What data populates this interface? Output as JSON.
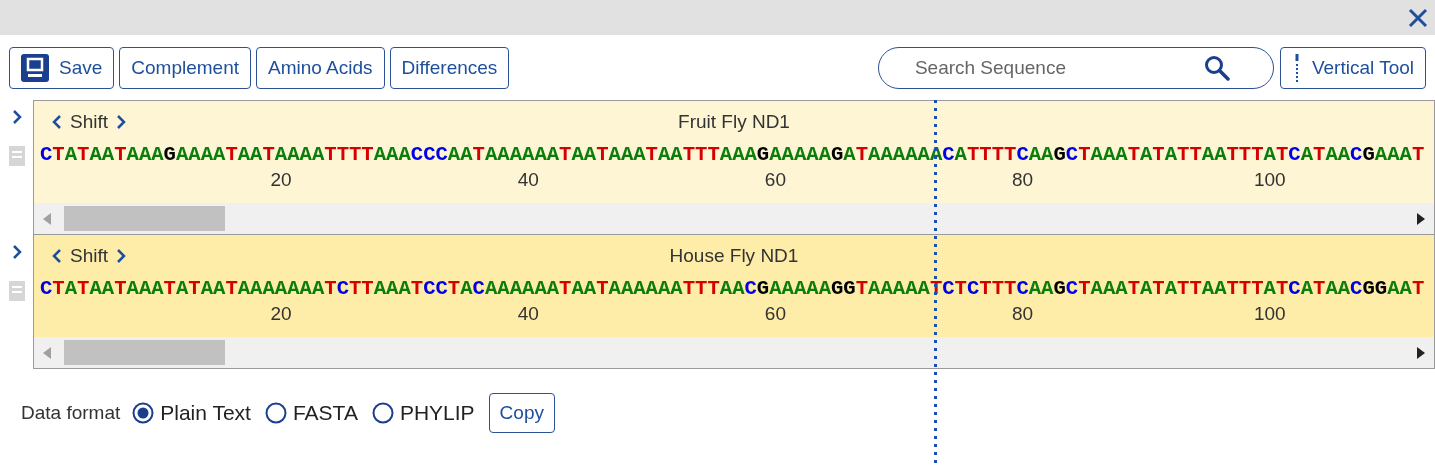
{
  "toolbar": {
    "buttons": [
      {
        "label": "Save",
        "kind": "save"
      },
      {
        "label": "Complement",
        "kind": "plain"
      },
      {
        "label": "Amino Acids",
        "kind": "plain"
      },
      {
        "label": "Differences",
        "kind": "plain"
      }
    ],
    "search": {
      "placeholder": "Search Sequence"
    },
    "vertical_tool": {
      "label": "Vertical Tool"
    }
  },
  "tracks": [
    {
      "shift_label": "Shift",
      "title": "Fruit Fly ND1",
      "selected": false,
      "sequence": "CTATAATAAAGAAAATAATAAAATTTTAAACCCAATAAAAAATAATAAATAATTTAAAGAAAAAGATAAAAAACATTTTCAAGCTAAATATATTAATTTATCATAACGAAAT",
      "ruler": [
        "20",
        "40",
        "60",
        "80",
        "100"
      ]
    },
    {
      "shift_label": "Shift",
      "title": "House Fly ND1",
      "selected": true,
      "sequence": "CTATAATAAATATAATAAAAAAATCTTAAATCCTACAAAAAATAATAAAAAATTTAACGAAAAAGGTAAAAATCTCTTTCAAGCTAAATATATTAATTTATCATAACGGAAT",
      "ruler": [
        "20",
        "40",
        "60",
        "80",
        "100"
      ]
    }
  ],
  "data_format": {
    "label": "Data format",
    "options": [
      {
        "label": "Plain Text",
        "selected": true
      },
      {
        "label": "FASTA",
        "selected": false
      },
      {
        "label": "PHYLIP",
        "selected": false
      }
    ],
    "copy": "Copy"
  }
}
